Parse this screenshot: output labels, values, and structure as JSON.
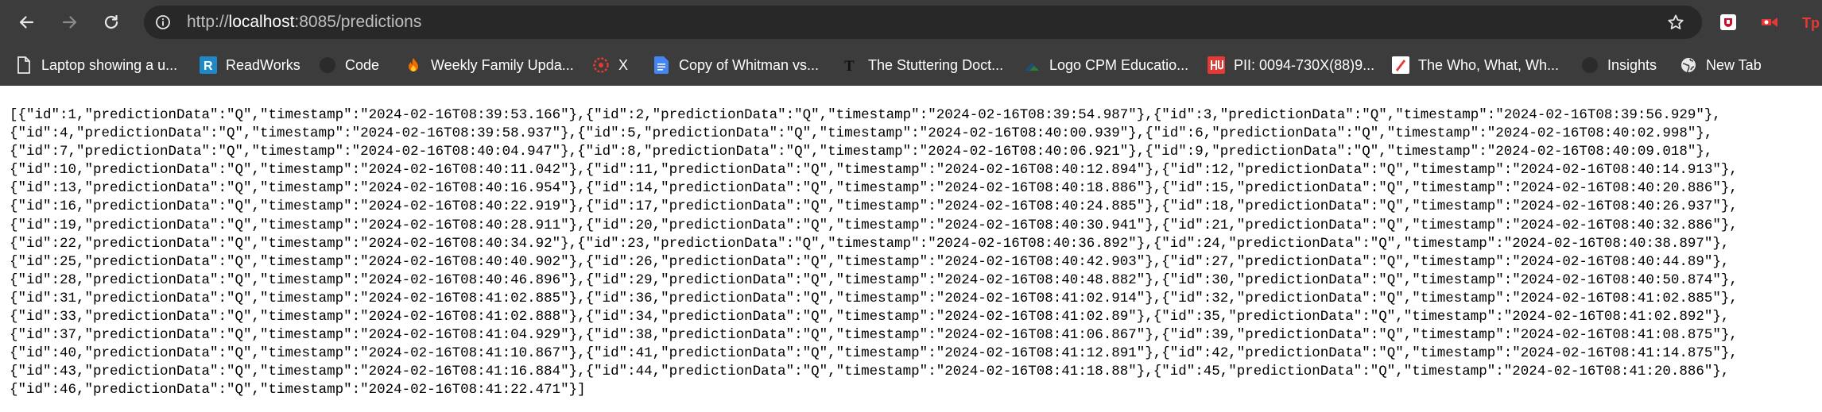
{
  "browser": {
    "url_scheme": "http://",
    "url_host": "localhost",
    "url_rest": ":8085/predictions",
    "bookmarks": [
      {
        "label": "Laptop showing a u...",
        "icon": "document-icon"
      },
      {
        "label": "ReadWorks",
        "icon": "readworks-icon"
      },
      {
        "label": "Code",
        "icon": "github-icon"
      },
      {
        "label": "Weekly Family Upda...",
        "icon": "flame-icon"
      },
      {
        "label": "X",
        "icon": "x-circle-icon"
      },
      {
        "label": "Copy of Whitman vs...",
        "icon": "google-docs-icon"
      },
      {
        "label": "The Stuttering Doct...",
        "icon": "nyt-icon"
      },
      {
        "label": "Logo CPM Educatio...",
        "icon": "cpm-icon"
      },
      {
        "label": "PII: 0094-730X(88)9...",
        "icon": "elsevier-icon"
      },
      {
        "label": "The Who, What, Wh...",
        "icon": "who-what-icon"
      },
      {
        "label": "Insights",
        "icon": "github-icon"
      },
      {
        "label": "New Tab",
        "icon": "globe-icon"
      }
    ]
  },
  "json_lines": [
    "[{\"id\":1,\"predictionData\":\"Q\",\"timestamp\":\"2024-02-16T08:39:53.166\"},{\"id\":2,\"predictionData\":\"Q\",\"timestamp\":\"2024-02-16T08:39:54.987\"},{\"id\":3,\"predictionData\":\"Q\",\"timestamp\":\"2024-02-16T08:39:56.929\"},",
    "{\"id\":4,\"predictionData\":\"Q\",\"timestamp\":\"2024-02-16T08:39:58.937\"},{\"id\":5,\"predictionData\":\"Q\",\"timestamp\":\"2024-02-16T08:40:00.939\"},{\"id\":6,\"predictionData\":\"Q\",\"timestamp\":\"2024-02-16T08:40:02.998\"},",
    "{\"id\":7,\"predictionData\":\"Q\",\"timestamp\":\"2024-02-16T08:40:04.947\"},{\"id\":8,\"predictionData\":\"Q\",\"timestamp\":\"2024-02-16T08:40:06.921\"},{\"id\":9,\"predictionData\":\"Q\",\"timestamp\":\"2024-02-16T08:40:09.018\"},",
    "{\"id\":10,\"predictionData\":\"Q\",\"timestamp\":\"2024-02-16T08:40:11.042\"},{\"id\":11,\"predictionData\":\"Q\",\"timestamp\":\"2024-02-16T08:40:12.894\"},{\"id\":12,\"predictionData\":\"Q\",\"timestamp\":\"2024-02-16T08:40:14.913\"},",
    "{\"id\":13,\"predictionData\":\"Q\",\"timestamp\":\"2024-02-16T08:40:16.954\"},{\"id\":14,\"predictionData\":\"Q\",\"timestamp\":\"2024-02-16T08:40:18.886\"},{\"id\":15,\"predictionData\":\"Q\",\"timestamp\":\"2024-02-16T08:40:20.886\"},",
    "{\"id\":16,\"predictionData\":\"Q\",\"timestamp\":\"2024-02-16T08:40:22.919\"},{\"id\":17,\"predictionData\":\"Q\",\"timestamp\":\"2024-02-16T08:40:24.885\"},{\"id\":18,\"predictionData\":\"Q\",\"timestamp\":\"2024-02-16T08:40:26.937\"},",
    "{\"id\":19,\"predictionData\":\"Q\",\"timestamp\":\"2024-02-16T08:40:28.911\"},{\"id\":20,\"predictionData\":\"Q\",\"timestamp\":\"2024-02-16T08:40:30.941\"},{\"id\":21,\"predictionData\":\"Q\",\"timestamp\":\"2024-02-16T08:40:32.886\"},",
    "{\"id\":22,\"predictionData\":\"Q\",\"timestamp\":\"2024-02-16T08:40:34.92\"},{\"id\":23,\"predictionData\":\"Q\",\"timestamp\":\"2024-02-16T08:40:36.892\"},{\"id\":24,\"predictionData\":\"Q\",\"timestamp\":\"2024-02-16T08:40:38.897\"},",
    "{\"id\":25,\"predictionData\":\"Q\",\"timestamp\":\"2024-02-16T08:40:40.902\"},{\"id\":26,\"predictionData\":\"Q\",\"timestamp\":\"2024-02-16T08:40:42.903\"},{\"id\":27,\"predictionData\":\"Q\",\"timestamp\":\"2024-02-16T08:40:44.89\"},",
    "{\"id\":28,\"predictionData\":\"Q\",\"timestamp\":\"2024-02-16T08:40:46.896\"},{\"id\":29,\"predictionData\":\"Q\",\"timestamp\":\"2024-02-16T08:40:48.882\"},{\"id\":30,\"predictionData\":\"Q\",\"timestamp\":\"2024-02-16T08:40:50.874\"},",
    "{\"id\":31,\"predictionData\":\"Q\",\"timestamp\":\"2024-02-16T08:41:02.885\"},{\"id\":36,\"predictionData\":\"Q\",\"timestamp\":\"2024-02-16T08:41:02.914\"},{\"id\":32,\"predictionData\":\"Q\",\"timestamp\":\"2024-02-16T08:41:02.885\"},",
    "{\"id\":33,\"predictionData\":\"Q\",\"timestamp\":\"2024-02-16T08:41:02.888\"},{\"id\":34,\"predictionData\":\"Q\",\"timestamp\":\"2024-02-16T08:41:02.89\"},{\"id\":35,\"predictionData\":\"Q\",\"timestamp\":\"2024-02-16T08:41:02.892\"},",
    "{\"id\":37,\"predictionData\":\"Q\",\"timestamp\":\"2024-02-16T08:41:04.929\"},{\"id\":38,\"predictionData\":\"Q\",\"timestamp\":\"2024-02-16T08:41:06.867\"},{\"id\":39,\"predictionData\":\"Q\",\"timestamp\":\"2024-02-16T08:41:08.875\"},",
    "{\"id\":40,\"predictionData\":\"Q\",\"timestamp\":\"2024-02-16T08:41:10.867\"},{\"id\":41,\"predictionData\":\"Q\",\"timestamp\":\"2024-02-16T08:41:12.891\"},{\"id\":42,\"predictionData\":\"Q\",\"timestamp\":\"2024-02-16T08:41:14.875\"},",
    "{\"id\":43,\"predictionData\":\"Q\",\"timestamp\":\"2024-02-16T08:41:16.884\"},{\"id\":44,\"predictionData\":\"Q\",\"timestamp\":\"2024-02-16T08:41:18.88\"},{\"id\":45,\"predictionData\":\"Q\",\"timestamp\":\"2024-02-16T08:41:20.886\"},",
    "{\"id\":46,\"predictionData\":\"Q\",\"timestamp\":\"2024-02-16T08:41:22.471\"}]"
  ]
}
